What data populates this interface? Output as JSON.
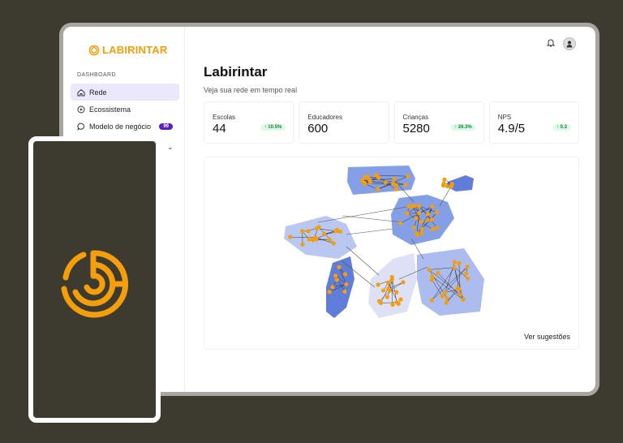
{
  "brand": {
    "name": "LABIRINTAR",
    "color": "#f59e0b"
  },
  "sidebar": {
    "section": "DASHBOARD",
    "items": [
      {
        "label": "Rede",
        "icon": "home-icon",
        "active": true
      },
      {
        "label": "Ecossistema",
        "icon": "play-circle-icon"
      },
      {
        "label": "Modelo de negócio",
        "icon": "chat-bubble-icon",
        "badge": "99"
      }
    ]
  },
  "header": {
    "icons": [
      "bell-icon",
      "user-avatar"
    ]
  },
  "page": {
    "title": "Labirintar",
    "subtitle": "Veja sua rede em tempo real"
  },
  "stats": [
    {
      "label": "Escolas",
      "value": "44",
      "delta": "10.5%"
    },
    {
      "label": "Educadores",
      "value": "600"
    },
    {
      "label": "Crianças",
      "value": "5280",
      "delta": "26.3%"
    },
    {
      "label": "NPS",
      "value": "4.9/5",
      "delta": "0.3"
    }
  ],
  "network": {
    "link_text": "Ver sugestões",
    "node_color": "#f59e0b",
    "cluster_colors": [
      "#5b7bd9",
      "#a8b8ee",
      "#dcdff6"
    ]
  }
}
